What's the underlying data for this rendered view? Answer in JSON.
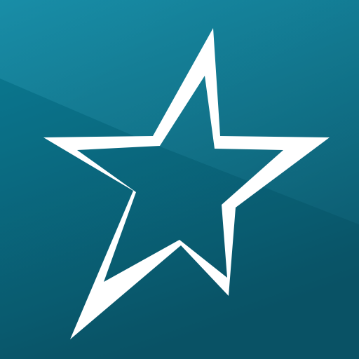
{
  "icon": {
    "name": "star-icon",
    "colors": {
      "background_top": "#0b87a2",
      "background_bottom": "#0a566a",
      "sheen": "#ffffff",
      "star_outline": "#ffffff"
    }
  }
}
